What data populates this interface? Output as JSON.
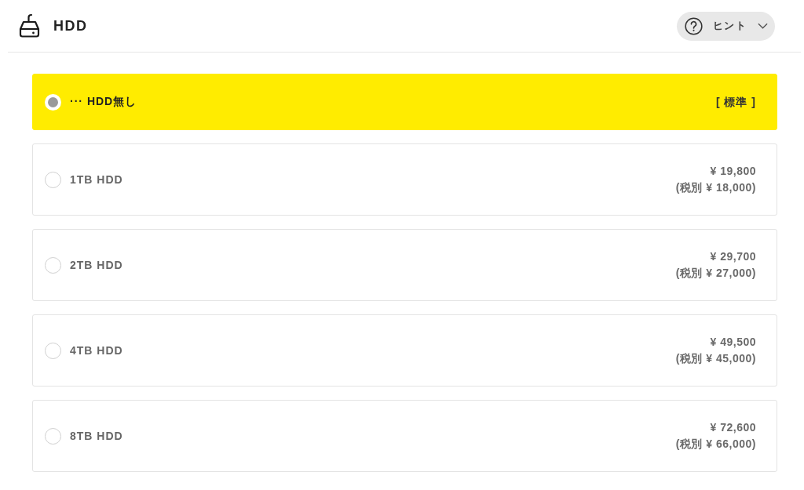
{
  "header": {
    "title": "HDD",
    "hint_button": {
      "label": "ヒント"
    }
  },
  "options": [
    {
      "label": "··· HDD無し",
      "selected": true,
      "note": "[ 標準 ]"
    },
    {
      "label": "1TB HDD",
      "selected": false,
      "price": "¥ 19,800",
      "price_ex_tax": "(税別 ¥ 18,000)"
    },
    {
      "label": "2TB HDD",
      "selected": false,
      "price": "¥ 29,700",
      "price_ex_tax": "(税別 ¥ 27,000)"
    },
    {
      "label": "4TB HDD",
      "selected": false,
      "price": "¥ 49,500",
      "price_ex_tax": "(税別 ¥ 45,000)"
    },
    {
      "label": "8TB HDD",
      "selected": false,
      "price": "¥ 72,600",
      "price_ex_tax": "(税別 ¥ 66,000)"
    }
  ]
}
